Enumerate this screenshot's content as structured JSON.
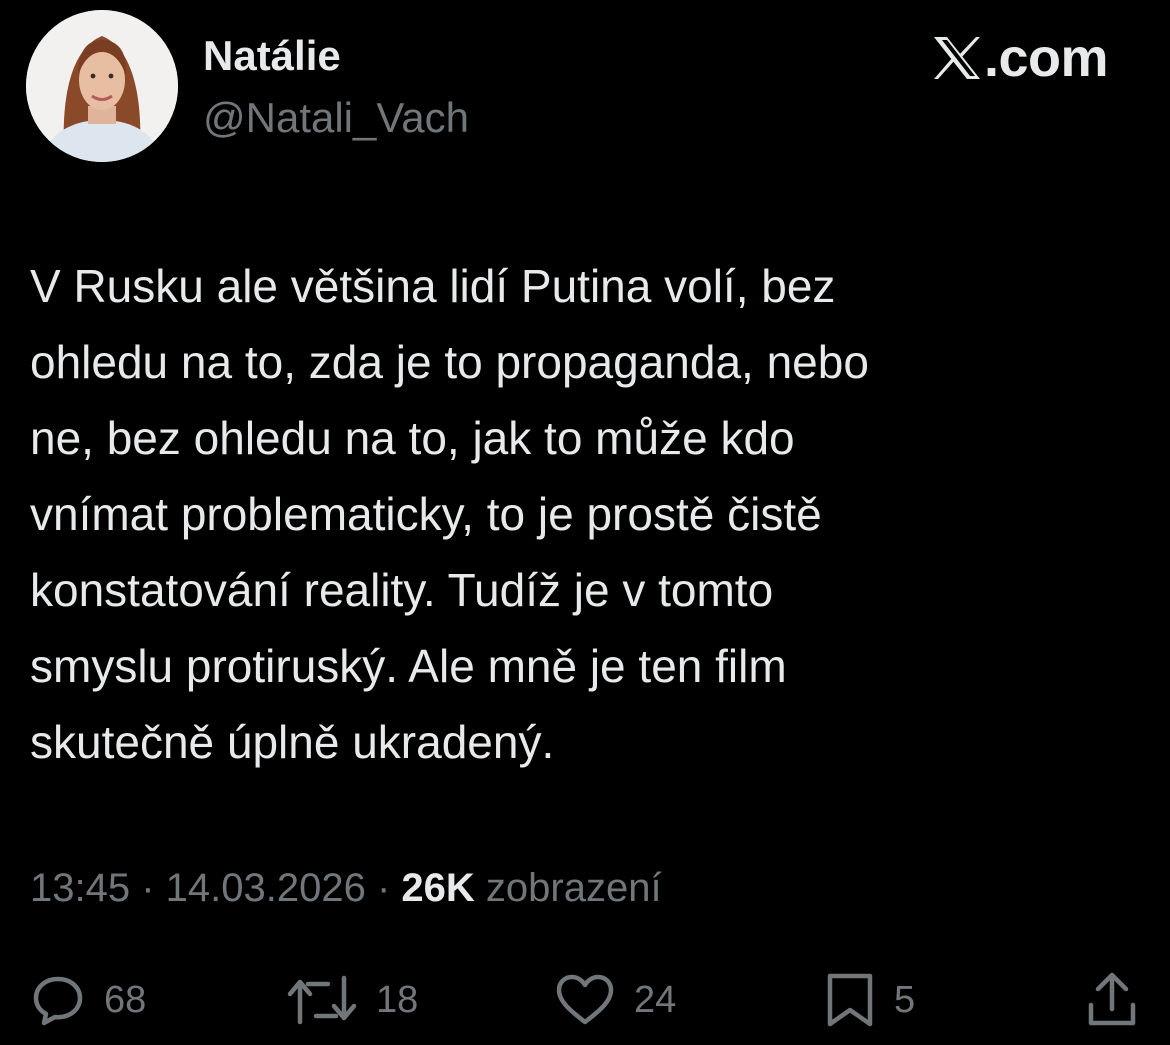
{
  "author": {
    "display_name": "Natálie",
    "handle": "@Natali_Vach",
    "avatar_icon": "profile-photo"
  },
  "brand": {
    "text": ".com",
    "icon": "x-logo-icon"
  },
  "tweet": {
    "lines": [
      "V Rusku ale většina lidí Putina volí, bez",
      "ohledu na to, zda je to propaganda, nebo",
      "ne, bez ohledu na to, jak to může kdo",
      "vnímat problematicky, to je prostě čistě",
      "konstatování reality. Tudíž je v tomto",
      "smyslu protiruský. Ale mně je ten film",
      "skutečně úplně ukradený."
    ]
  },
  "meta": {
    "time": "13:45",
    "separator": " · ",
    "date": "14.03.2026",
    "views_count": "26K",
    "views_label": " zobrazení"
  },
  "actions": {
    "replies": "68",
    "reposts": "18",
    "likes": "24",
    "bookmarks": "5"
  },
  "colors": {
    "background": "#000000",
    "primary_text": "#e7e9ea",
    "secondary_text": "#71767b"
  }
}
